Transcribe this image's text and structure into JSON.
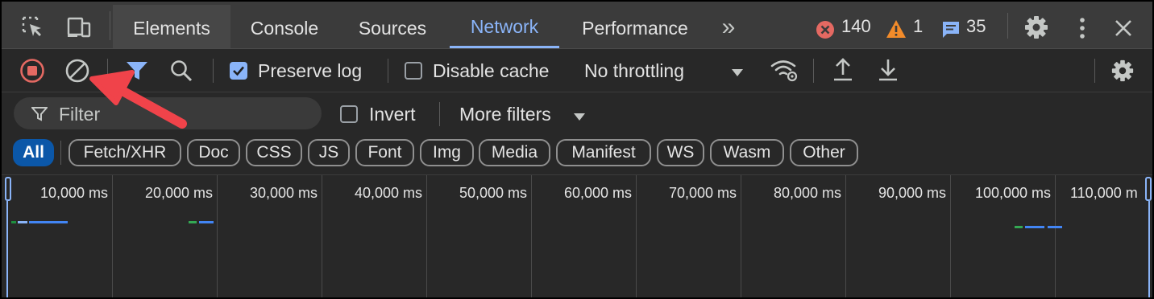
{
  "tabs": [
    {
      "label": "Elements"
    },
    {
      "label": "Console"
    },
    {
      "label": "Sources"
    },
    {
      "label": "Network"
    },
    {
      "label": "Performance"
    }
  ],
  "more_tabs_glyph": "»",
  "status": {
    "errors": "140",
    "warnings": "1",
    "messages": "35"
  },
  "toolbar": {
    "preserve_log": {
      "label": "Preserve log",
      "checked": true
    },
    "disable_cache": {
      "label": "Disable cache",
      "checked": false
    },
    "throttling": "No throttling"
  },
  "filter": {
    "placeholder": "Filter",
    "invert": {
      "label": "Invert",
      "checked": false
    },
    "more_filters": "More filters"
  },
  "type_filters": [
    "All",
    "Fetch/XHR",
    "Doc",
    "CSS",
    "JS",
    "Font",
    "Img",
    "Media",
    "Manifest",
    "WS",
    "Wasm",
    "Other"
  ],
  "type_filter_active": "All",
  "timeline": {
    "ticks": [
      "10,000 ms",
      "20,000 ms",
      "30,000 ms",
      "40,000 ms",
      "50,000 ms",
      "60,000 ms",
      "70,000 ms",
      "80,000 ms",
      "90,000 ms",
      "100,000 ms",
      "110,000 m"
    ]
  },
  "colors": {
    "accent": "#8ab4f8",
    "record": "#e46962",
    "error": "#e46962",
    "warning": "#f28b2a",
    "chip_active": "#0b57a8",
    "annotation_arrow": "#f0434a"
  },
  "icons": [
    "inspect-element-icon",
    "device-toolbar-icon",
    "error-icon",
    "warning-icon",
    "message-icon",
    "settings-icon",
    "kebab-menu-icon",
    "close-icon",
    "record-stop-icon",
    "clear-icon",
    "filter-funnel-icon",
    "search-icon",
    "network-conditions-icon",
    "import-har-icon",
    "export-har-icon",
    "filter-icon",
    "dropdown-arrow-icon"
  ]
}
